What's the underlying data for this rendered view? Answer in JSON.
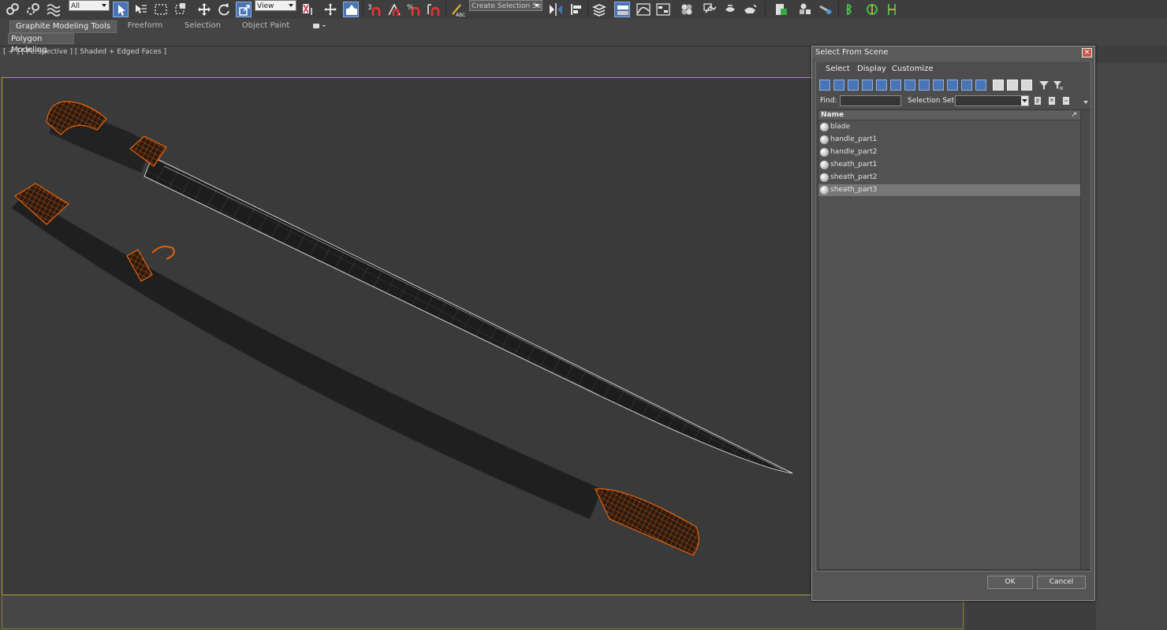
{
  "toolbar": {
    "filter_value": "All",
    "ref_coord_value": "View",
    "named_selection_placeholder": "Create Selection Se"
  },
  "ribbon": {
    "tabs": [
      "Graphite Modeling Tools",
      "Freeform",
      "Selection",
      "Object Paint"
    ],
    "subtab": "Polygon Modeling"
  },
  "viewport": {
    "label": "[ + ] [ Perspective ] [ Shaded + Edged Faces ]"
  },
  "dialog": {
    "title": "Select From Scene",
    "close_glyph": "✕",
    "menu": [
      "Select",
      "Display",
      "Customize"
    ],
    "find_label": "Find:",
    "selection_set_label": "Selection Set:",
    "column_name": "Name",
    "sort_glyph": "↗",
    "items": [
      "blade",
      "handle_part1",
      "handle_part2",
      "sheath_part1",
      "sheath_part2",
      "sheath_part3"
    ],
    "selected_item": "sheath_part3",
    "ok_label": "OK",
    "cancel_label": "Cancel"
  },
  "colors": {
    "accent_orange": "#e0620e",
    "viewport_border": "#b69c3b",
    "active_icon_blue": "#4a74b3"
  }
}
